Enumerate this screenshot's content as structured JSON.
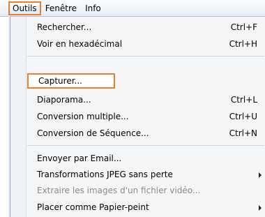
{
  "menubar": {
    "items": [
      "Outils",
      "Fenêtre",
      "Info"
    ]
  },
  "menu": {
    "items": [
      {
        "label": "Rechercher...",
        "shortcut": "Ctrl+F"
      },
      {
        "label": "Voir en hexadécimal",
        "shortcut": "Ctrl+H"
      },
      {
        "label": "Capturer...",
        "shortcut": ""
      },
      {
        "label": "Diaporama...",
        "shortcut": "Ctrl+L"
      },
      {
        "label": "Conversion multiple...",
        "shortcut": "Ctrl+U"
      },
      {
        "label": "Conversion de Séquence...",
        "shortcut": "Ctrl+N"
      },
      {
        "label": "Envoyer par Email...",
        "shortcut": ""
      },
      {
        "label": "Transformations JPEG sans perte",
        "shortcut": ""
      },
      {
        "label": "Extraire les images d'un fichier vidéo...",
        "shortcut": ""
      },
      {
        "label": "Placer comme Papier-peint",
        "shortcut": ""
      }
    ]
  },
  "colors": {
    "highlight_border": "#f07d28",
    "disabled_text": "#8a8a8a"
  }
}
